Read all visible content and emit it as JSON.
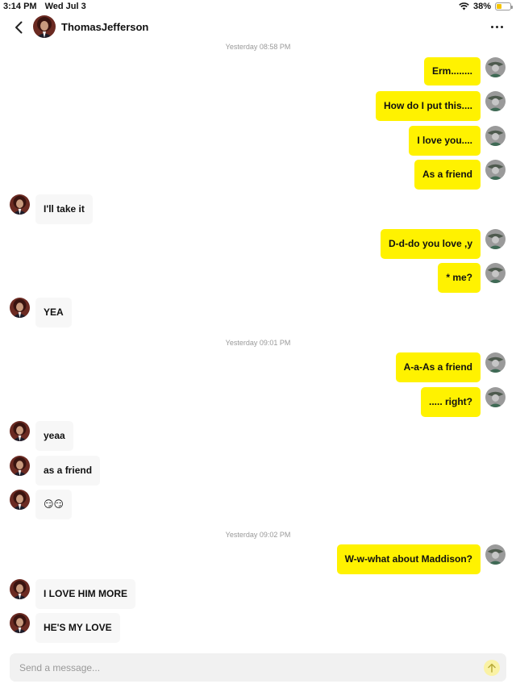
{
  "status_bar": {
    "time": "3:14 PM",
    "date": "Wed Jul 3",
    "battery": "38%",
    "battery_level": 0.38
  },
  "header": {
    "contact_name": "ThomasJefferson"
  },
  "timestamps": [
    "Yesterday 08:58 PM",
    "Yesterday 09:01 PM",
    "Yesterday 09:02 PM"
  ],
  "messages": [
    "Erm........",
    "How do I put this....",
    "I love you....",
    "As a friend",
    "I'll take it",
    "D-d-do you love ,y",
    "* me?",
    "YEA",
    "A-a-As a friend",
    "..... right?",
    "yeaa",
    "as a friend",
    "😏😏",
    "W-w-what about Maddison?",
    "I LOVE HIM MORE",
    "HE'S MY LOVE"
  ],
  "composer": {
    "placeholder": "Send a message..."
  },
  "colors": {
    "outgoing_bubble": "#fff200",
    "incoming_bubble": "#f7f7f7",
    "send_button": "#faf2a5"
  }
}
